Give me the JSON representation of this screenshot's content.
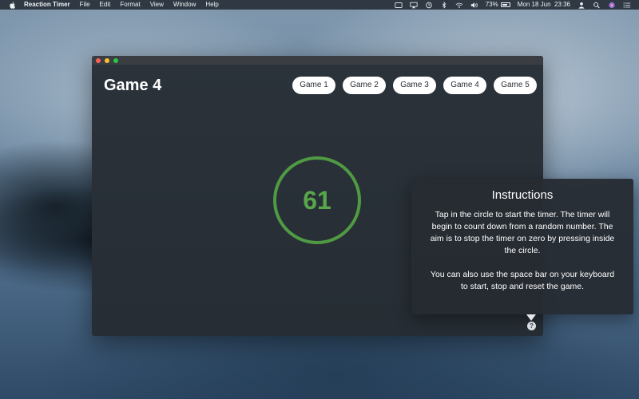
{
  "menubar": {
    "app_name": "Reaction Timer",
    "menus": [
      "File",
      "Edit",
      "Format",
      "View",
      "Window",
      "Help"
    ],
    "status": {
      "battery_percent": "73%",
      "battery_level": 0.73,
      "datetime": "Mon 18 Jun  23:36"
    },
    "icons": [
      "screen-mirror-icon",
      "airplay-icon",
      "time-machine-icon",
      "bluetooth-icon",
      "wifi-icon",
      "volume-icon",
      "battery-icon",
      "user-icon",
      "spotlight-icon",
      "siri-icon",
      "notification-center-icon"
    ]
  },
  "window": {
    "game_title": "Game 4",
    "tabs": [
      "Game 1",
      "Game 2",
      "Game 3",
      "Game 4",
      "Game 5"
    ],
    "timer_value": "61",
    "accent_color": "#4f9a43"
  },
  "instructions": {
    "title": "Instructions",
    "paragraph1": "Tap in the circle to start the timer. The timer will begin to count down from a random number. The aim is to stop the timer on zero by pressing inside the circle.",
    "paragraph2": "You can also use the space bar on your keyboard to start, stop and reset the game.",
    "help_glyph": "?"
  }
}
